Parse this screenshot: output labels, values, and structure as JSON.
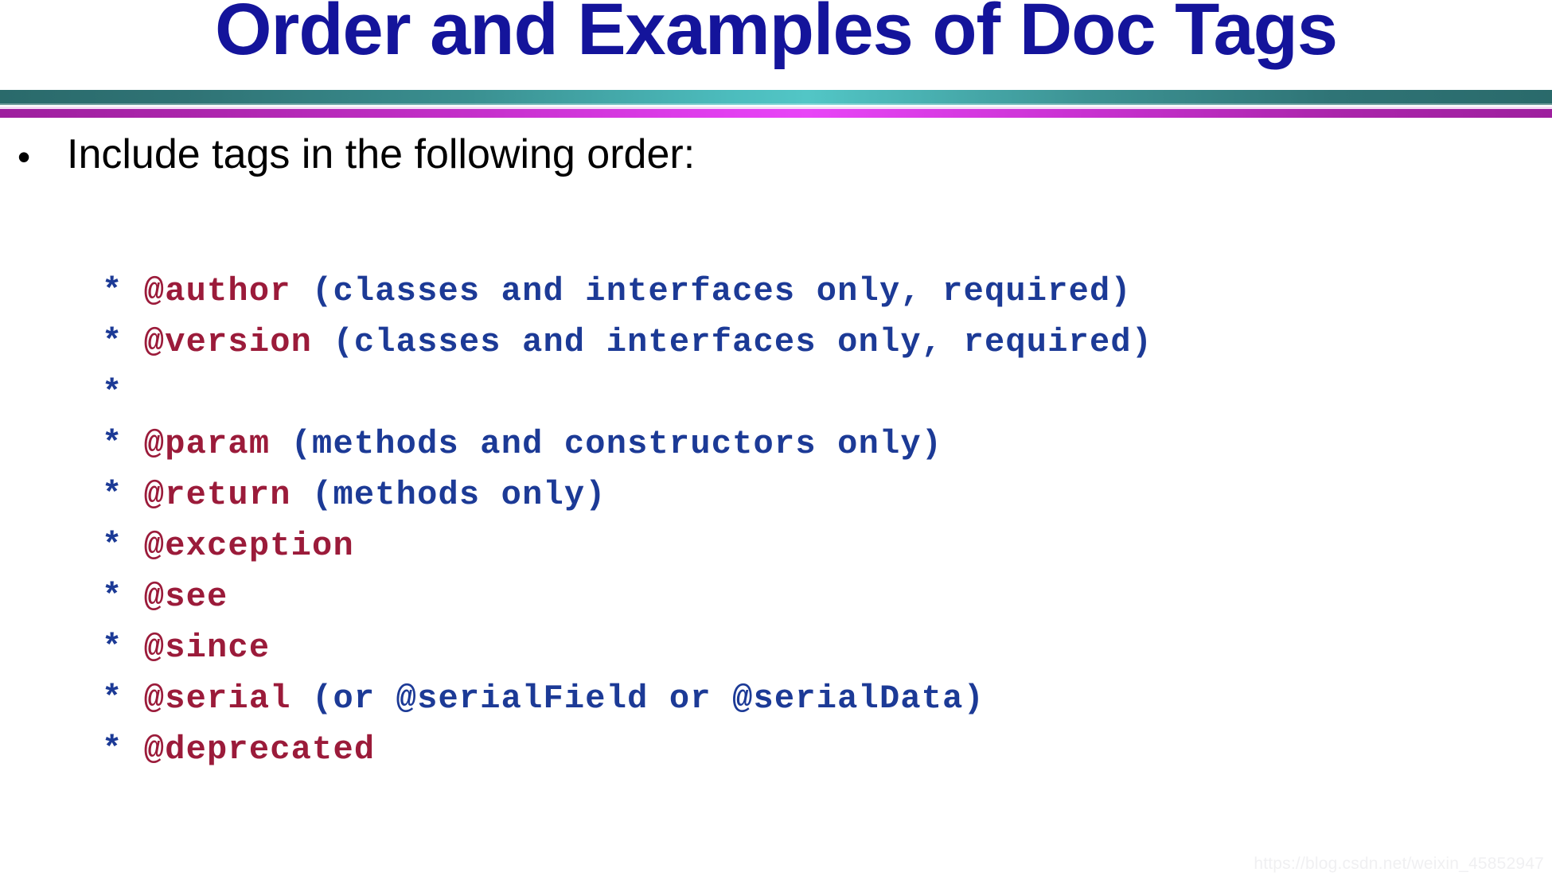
{
  "slide": {
    "title": "Order and Examples of Doc Tags",
    "bullet_marker": "•",
    "bullet_text": "Include tags in the following order:",
    "watermark": "https://blog.csdn.net/weixin_45852947"
  },
  "colors": {
    "title": "#14149B",
    "tag_red": "#9B1B3A",
    "code_blue": "#1C3A96",
    "bar_teal_dark": "#2A6A6B",
    "bar_teal_light": "#52C6C6",
    "bar_magenta_dark": "#9E1F9E",
    "bar_magenta_light": "#E845F7",
    "body_text": "#000000",
    "watermark": "#F0F0F2"
  },
  "code_lines": [
    {
      "star": "*",
      "tag": " @author",
      "rest": " (classes and interfaces only, required)"
    },
    {
      "star": "*",
      "tag": " @version",
      "rest": " (classes and interfaces only, required)"
    },
    {
      "star": "*",
      "tag": "",
      "rest": ""
    },
    {
      "star": "*",
      "tag": " @param",
      "rest": " (methods and constructors only)"
    },
    {
      "star": "*",
      "tag": " @return",
      "rest": " (methods only)"
    },
    {
      "star": "*",
      "tag": " @exception",
      "rest": ""
    },
    {
      "star": "*",
      "tag": " @see",
      "rest": ""
    },
    {
      "star": "*",
      "tag": " @since",
      "rest": ""
    },
    {
      "star": "*",
      "tag": " @serial",
      "rest": " (or @serialField or @serialData)"
    },
    {
      "star": "*",
      "tag": " @deprecated",
      "rest": ""
    }
  ]
}
